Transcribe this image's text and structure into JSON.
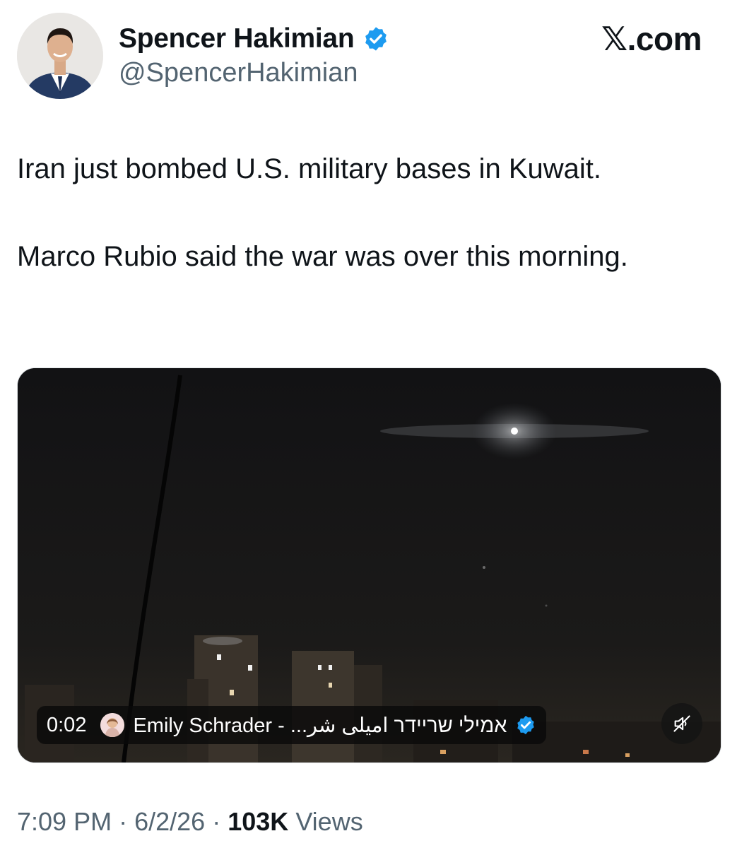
{
  "author": {
    "display_name": "Spencer Hakimian",
    "handle": "@SpencerHakimian",
    "verified": true,
    "badge_color": "#1d9bf0"
  },
  "brand": "𝕏.com",
  "tweet": {
    "paragraph_1": "Iran just bombed U.S. military bases in Kuwait.",
    "paragraph_2": "Marco Rubio said the war was over this morning."
  },
  "video": {
    "timestamp": "0:02",
    "source_name": "Emily Schrader - ...אמילי שריידר امیلی شر",
    "source_verified": true,
    "muted": true,
    "mute_icon": "speaker-muted-icon"
  },
  "meta": {
    "time": "7:09 PM",
    "separator": "·",
    "date": "6/2/26",
    "views_count": "103K",
    "views_label": "Views"
  },
  "colors": {
    "text_primary": "#0f1419",
    "text_secondary": "#536471",
    "verified_blue": "#1d9bf0"
  }
}
